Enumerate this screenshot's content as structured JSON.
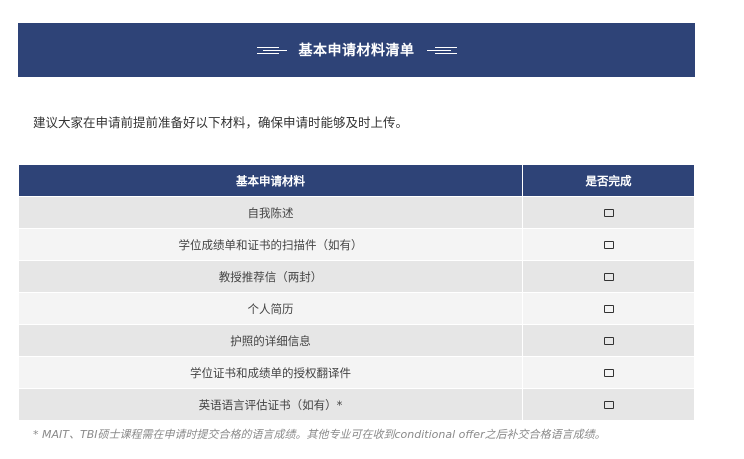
{
  "banner": {
    "title": "基本申请材料清单"
  },
  "intro": "建议大家在申请前提前准备好以下材料，确保申请时能够及时上传。",
  "table": {
    "headers": {
      "material": "基本申请材料",
      "completed": "是否完成"
    },
    "rows": [
      {
        "material": "自我陈述",
        "status": "☐"
      },
      {
        "material": "学位成绩单和证书的扫描件（如有）",
        "status": "☐"
      },
      {
        "material": "教授推荐信（两封）",
        "status": "☐"
      },
      {
        "material": "个人简历",
        "status": "☐"
      },
      {
        "material": "护照的详细信息",
        "status": "☐"
      },
      {
        "material": "学位证书和成绩单的授权翻译件",
        "status": "☐"
      },
      {
        "material": "英语语言评估证书（如有）*",
        "status": "☐"
      }
    ]
  },
  "footnote": "* MAIT、TBI硕士课程需在申请时提交合格的语言成绩。其他专业可在收到conditional offer之后补交合格语言成绩。",
  "colors": {
    "header_bg": "#2e4377",
    "row_odd": "#e6e6e6",
    "row_even": "#f4f4f4"
  }
}
